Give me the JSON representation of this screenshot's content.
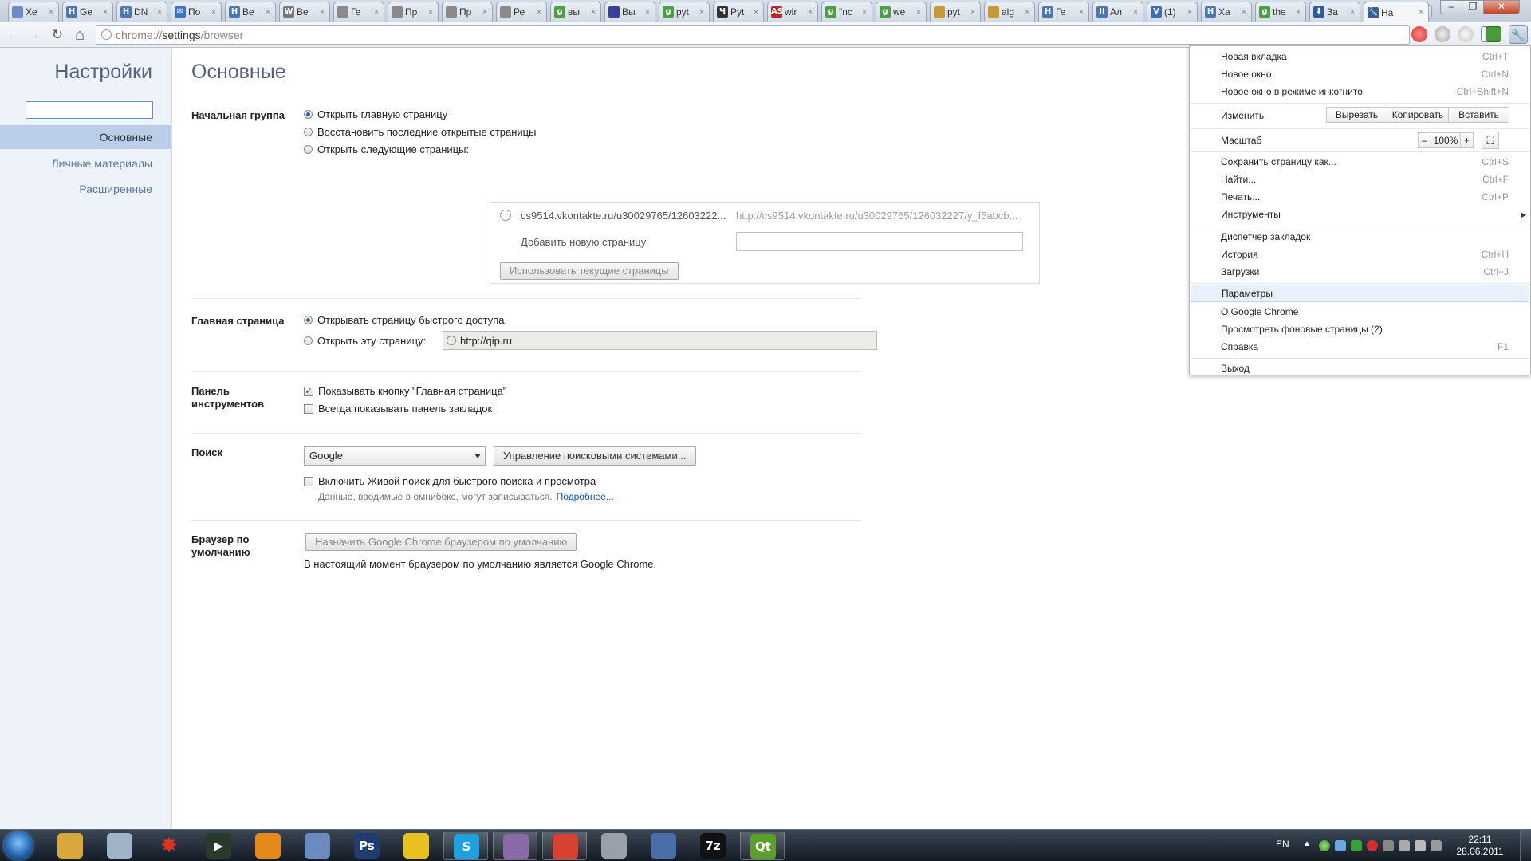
{
  "window": {
    "minimize": "–",
    "maximize": "❐",
    "close": "✕"
  },
  "tabs": [
    {
      "label": "Хе",
      "fav": "",
      "color": "#6b8cc7"
    },
    {
      "label": "Ge",
      "fav": "H",
      "color": "#4a78b5"
    },
    {
      "label": "DN",
      "fav": "H",
      "color": "#4a78b5"
    },
    {
      "label": "По",
      "fav": "✉",
      "color": "#3d73c9"
    },
    {
      "label": "Ве",
      "fav": "H",
      "color": "#4a78b5"
    },
    {
      "label": "Ве",
      "fav": "W",
      "color": "#777777"
    },
    {
      "label": "Ге",
      "fav": "",
      "color": "#8a8a8a"
    },
    {
      "label": "Пр",
      "fav": "",
      "color": "#8a8a8a"
    },
    {
      "label": "Пр",
      "fav": "",
      "color": "#8a8a8a"
    },
    {
      "label": "Ре",
      "fav": "",
      "color": "#8a8a8a"
    },
    {
      "label": "вы",
      "fav": "g",
      "color": "#4aa040"
    },
    {
      "label": "Вы",
      "fav": "",
      "color": "#3a3f9a"
    },
    {
      "label": "pyt",
      "fav": "g",
      "color": "#4aa040"
    },
    {
      "label": "Pyt",
      "fav": "Ч",
      "color": "#333333"
    },
    {
      "label": "wir",
      "fav": "AS",
      "color": "#b02a2a"
    },
    {
      "label": "\"nc",
      "fav": "g",
      "color": "#4aa040"
    },
    {
      "label": "we",
      "fav": "g",
      "color": "#4aa040"
    },
    {
      "label": "pyt",
      "fav": "",
      "color": "#c89838"
    },
    {
      "label": "alg",
      "fav": "",
      "color": "#c89838"
    },
    {
      "label": "Ге",
      "fav": "H",
      "color": "#4a78b5"
    },
    {
      "label": "Ал",
      "fav": "II",
      "color": "#4a78b5"
    },
    {
      "label": "(1)",
      "fav": "V",
      "color": "#3d6fb5"
    },
    {
      "label": "Ха",
      "fav": "H",
      "color": "#4a78b5"
    },
    {
      "label": "the",
      "fav": "g",
      "color": "#4aa040"
    },
    {
      "label": "За",
      "fav": "⬇",
      "color": "#2e5a9e"
    },
    {
      "label": "На",
      "fav": "🔧",
      "color": "#3a5f99",
      "active": true
    }
  ],
  "new_tab": "+",
  "toolbar": {
    "back_icon": "←",
    "forward_icon": "→",
    "reload_icon": "↻",
    "home_icon": "⌂",
    "url_scheme": "chrome://",
    "url_host": "settings",
    "url_path": "/browser",
    "star_icon": "☆",
    "wrench_icon": "🔧",
    "ext_gmail": "M"
  },
  "sidebar": {
    "title": "Настройки",
    "items": [
      {
        "label": "Основные",
        "selected": true
      },
      {
        "label": "Личные материалы"
      },
      {
        "label": "Расширенные"
      }
    ]
  },
  "main": {
    "heading": "Основные",
    "startup": {
      "label": "Начальная группа",
      "opt_home": "Открыть главную страницу",
      "opt_restore": "Восстановить последние открытые страницы",
      "opt_pages": "Открыть следующие страницы:",
      "item_title": "cs9514.vkontakte.ru/u30029765/12603222...",
      "item_url": "http://cs9514.vkontakte.ru/u30029765/126032227/y_f5abcb...",
      "add_page": "Добавить новую страницу",
      "use_current": "Использовать текущие страницы"
    },
    "homepage": {
      "label": "Главная страница",
      "opt_ntp": "Открывать страницу быстрого доступа",
      "opt_url": "Открыть эту страницу:",
      "url": "http://qip.ru"
    },
    "toolbar_section": {
      "label": "Панель инструментов",
      "show_home": "Показывать кнопку \"Главная страница\"",
      "show_bookmarks": "Всегда показывать панель закладок",
      "check_mark": "✓"
    },
    "search": {
      "label": "Поиск",
      "engine": "Google",
      "manage": "Управление поисковыми системами...",
      "instant": "Включить Живой поиск для быстрого поиска и просмотра",
      "note": "Данные, вводимые в омнибокс, могут записываться.",
      "more": "Подробнее..."
    },
    "default_browser": {
      "label": "Браузер по умолчанию",
      "button": "Назначить Google Chrome браузером по умолчанию",
      "status": "В настоящий момент браузером по умолчанию является Google Chrome."
    }
  },
  "menu": {
    "new_tab": {
      "label": "Новая вкладка",
      "acc": "Ctrl+T"
    },
    "new_window": {
      "label": "Новое окно",
      "acc": "Ctrl+N"
    },
    "incognito": {
      "label": "Новое окно в режиме инкогнито",
      "acc": "Ctrl+Shift+N"
    },
    "edit": {
      "label": "Изменить",
      "cut": "Вырезать",
      "copy": "Копировать",
      "paste": "Вставить"
    },
    "zoom": {
      "label": "Масштаб",
      "minus": "–",
      "value": "100%",
      "plus": "+",
      "fullscreen_icon": "⛶"
    },
    "save": {
      "label": "Сохранить страницу как...",
      "acc": "Ctrl+S"
    },
    "find": {
      "label": "Найти...",
      "acc": "Ctrl+F"
    },
    "print": {
      "label": "Печать...",
      "acc": "Ctrl+P"
    },
    "tools": {
      "label": "Инструменты",
      "arrow": "▸"
    },
    "bookmarks": {
      "label": "Диспетчер закладок"
    },
    "history": {
      "label": "История",
      "acc": "Ctrl+H"
    },
    "downloads": {
      "label": "Загрузки",
      "acc": "Ctrl+J"
    },
    "options": {
      "label": "Параметры"
    },
    "about": {
      "label": "О Google Chrome"
    },
    "background": {
      "label": "Просмотреть фоновые страницы (2)"
    },
    "help": {
      "label": "Справка",
      "acc": "F1"
    },
    "exit": {
      "label": "Выход"
    }
  },
  "taskbar": {
    "apps": [
      {
        "name": "explorer",
        "glyph": "",
        "color": "#d8a93a"
      },
      {
        "name": "calculator",
        "glyph": "",
        "color": "#9fb4c8"
      },
      {
        "name": "burst",
        "glyph": "✸",
        "color": "transparent",
        "fg": "#e03020"
      },
      {
        "name": "terminal",
        "glyph": "▶",
        "color": "#2a3a2a"
      },
      {
        "name": "eclipse",
        "glyph": "",
        "color": "#e58a1a"
      },
      {
        "name": "ide",
        "glyph": "",
        "color": "#6a8ac0"
      },
      {
        "name": "photoshop",
        "glyph": "Ps",
        "color": "#1f3b70"
      },
      {
        "name": "qip",
        "glyph": "",
        "color": "#e8c020"
      },
      {
        "name": "skype",
        "glyph": "S",
        "color": "#1ea1e0",
        "running": true
      },
      {
        "name": "pidgin",
        "glyph": "",
        "color": "#8a6aa8",
        "running": true
      },
      {
        "name": "chrome",
        "glyph": "",
        "color": "#d84030",
        "running": true
      },
      {
        "name": "media",
        "glyph": "",
        "color": "#9aa0a8"
      },
      {
        "name": "python",
        "glyph": "",
        "color": "#4a6ea8"
      },
      {
        "name": "7zip",
        "glyph": "7z",
        "color": "#111111"
      },
      {
        "name": "qtcreator",
        "glyph": "Qt",
        "color": "#5aa02a",
        "running": true
      }
    ],
    "lang": "EN",
    "time": "22:11",
    "date": "28.06.2011"
  }
}
